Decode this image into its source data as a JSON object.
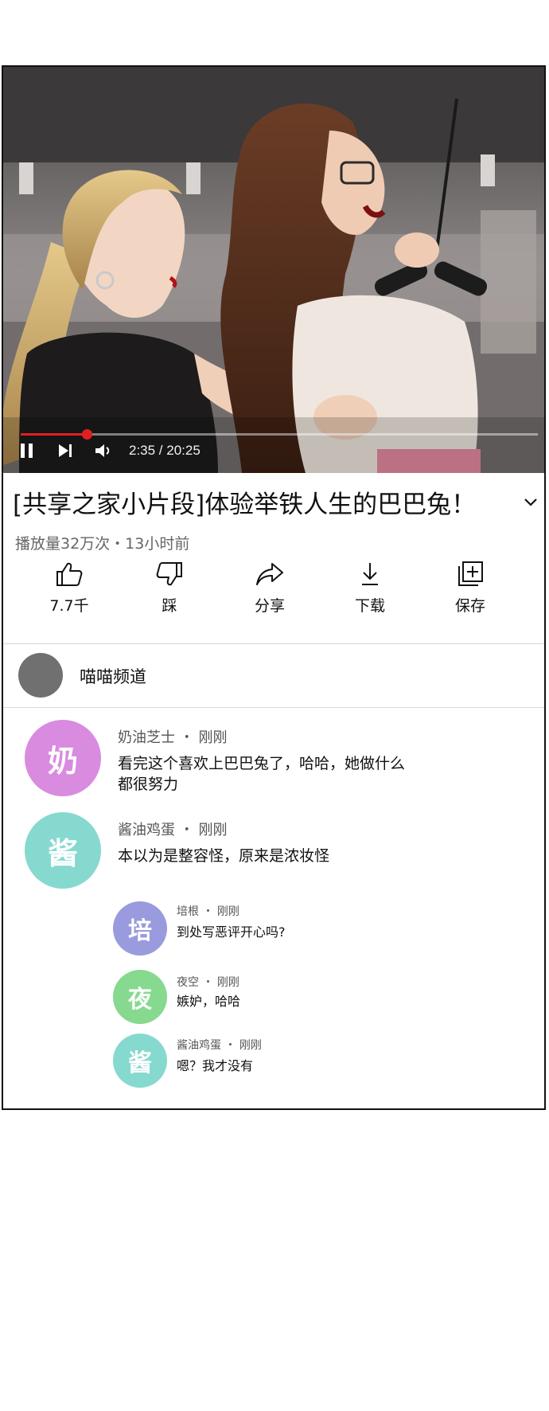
{
  "video": {
    "progress": 0.128,
    "time_label": "2:35 / 20:25",
    "colors": {
      "played": "#e02020"
    }
  },
  "title": "[共享之家小片段]体验举铁人生的巴巴兔！",
  "meta": "播放量32万次・13小时前",
  "actions": {
    "like": {
      "label": "7.7千",
      "icon": "thumbs-up-icon"
    },
    "dislike": {
      "label": "踩",
      "icon": "thumbs-down-icon"
    },
    "share": {
      "label": "分享",
      "icon": "share-icon"
    },
    "download": {
      "label": "下载",
      "icon": "download-icon"
    },
    "save": {
      "label": "保存",
      "icon": "add-to-playlist-icon"
    }
  },
  "channel": {
    "name": "喵喵频道"
  },
  "comments": [
    {
      "avatar_char": "奶",
      "avatar_color": "#d98be0",
      "name": "奶油芝士",
      "time": "刚刚",
      "lines": [
        "看完这个喜欢上巴巴兔了，哈哈，她做什么",
        "都很努力"
      ]
    },
    {
      "avatar_char": "酱",
      "avatar_color": "#86d9cf",
      "name": "酱油鸡蛋",
      "time": "刚刚",
      "lines": [
        "本以为是整容怪，原来是浓妆怪"
      ]
    }
  ],
  "replies": [
    {
      "avatar_char": "培",
      "avatar_color": "#9a9bde",
      "name": "培根",
      "time": "刚刚",
      "text": "到处写恶评开心吗?"
    },
    {
      "avatar_char": "夜",
      "avatar_color": "#86d98f",
      "name": "夜空",
      "time": "刚刚",
      "text": "嫉妒，哈哈"
    },
    {
      "avatar_char": "酱",
      "avatar_color": "#86d9cf",
      "name": "酱油鸡蛋",
      "time": "刚刚",
      "text": "嗯？我才没有"
    }
  ]
}
